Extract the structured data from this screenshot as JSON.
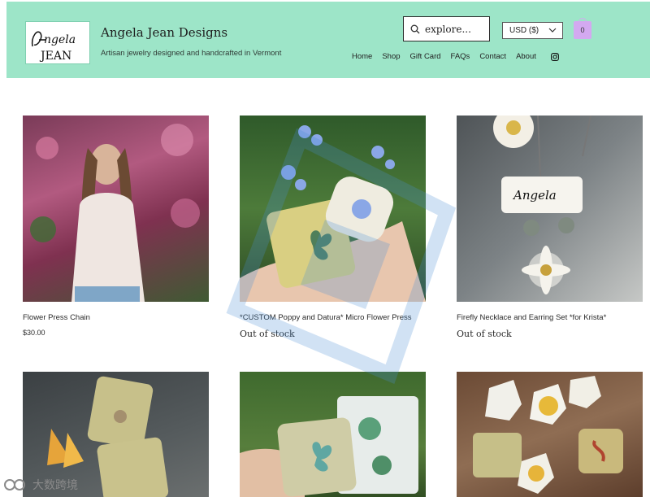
{
  "header": {
    "logo_text": "Angela JEAN",
    "site_title": "Angela Jean Designs",
    "tagline": "Artisan jewelry designed and handcrafted in Vermont",
    "search_placeholder": "explore...",
    "currency": "USD ($)",
    "cart_count": "0",
    "nav": [
      "Home",
      "Shop",
      "Gift Card",
      "FAQs",
      "Contact",
      "About"
    ],
    "colors": {
      "header_bg": "#9de5c8",
      "cart": "#d3a9f0"
    }
  },
  "products": [
    {
      "name": "Flower Press Chain",
      "price": "$30.00",
      "status": ""
    },
    {
      "name": "*CUSTOM Poppy and Datura* Micro Flower Press",
      "price": "",
      "status": "Out of stock"
    },
    {
      "name": "Firefly Necklace and Earring Set *for Krista*",
      "price": "",
      "status": "Out of stock"
    },
    {
      "name": "",
      "price": "",
      "status": ""
    },
    {
      "name": "",
      "price": "",
      "status": ""
    },
    {
      "name": "",
      "price": "",
      "status": ""
    }
  ],
  "watermark": "大数跨境"
}
